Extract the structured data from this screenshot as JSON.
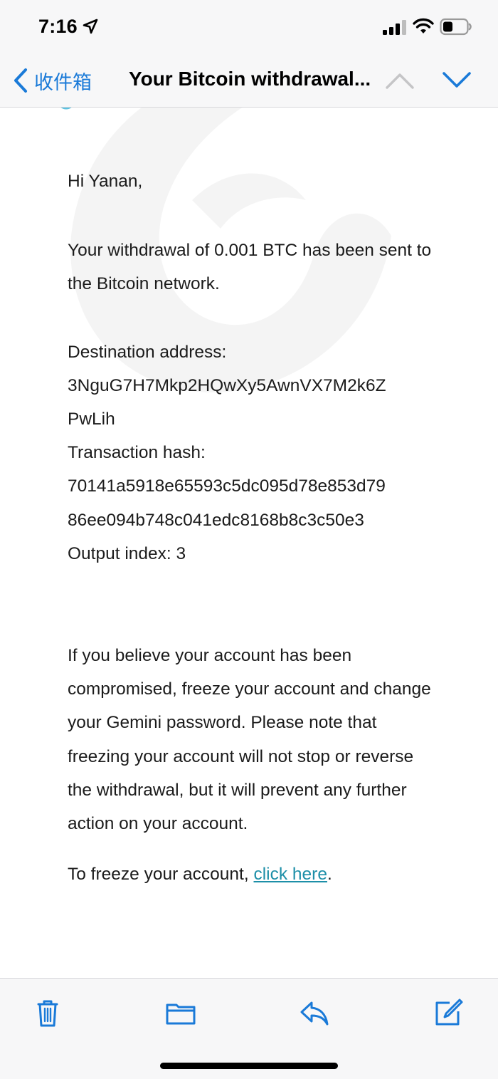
{
  "status_bar": {
    "time": "7:16"
  },
  "nav": {
    "back_label": "收件箱",
    "title": "Your Bitcoin withdrawal..."
  },
  "email": {
    "greeting": "Hi Yanan,",
    "intro": "Your withdrawal of 0.001 BTC has been sent to the Bitcoin network.",
    "destination_label": "Destination address:",
    "destination_line1": "3NguG7H7Mkp2HQwXy5AwnVX7M2k6Z",
    "destination_line2": "PwLih",
    "tx_label": "Transaction hash:",
    "tx_line1": "70141a5918e65593c5dc095d78e853d79",
    "tx_line2": "86ee094b748c041edc8168b8c3c50e3",
    "output_index": "Output index: 3",
    "warning": "If you believe your account has been compromised, freeze your account and change your Gemini password. Please note that freezing your account will not stop or reverse the withdrawal, but it will prevent any further action on your account.",
    "freeze_prefix": "To freeze your account, ",
    "freeze_link": "click here",
    "freeze_suffix": "."
  },
  "icons": {
    "back": "chevron-left-icon",
    "prev": "chevron-up-icon",
    "next": "chevron-down-icon",
    "trash": "trash-icon",
    "folder": "folder-icon",
    "reply": "reply-icon",
    "compose": "compose-icon"
  },
  "colors": {
    "accent": "#1a7ad8",
    "link": "#1d8fa8",
    "disabled": "#c5c5c7",
    "text": "#1b1b1b"
  }
}
